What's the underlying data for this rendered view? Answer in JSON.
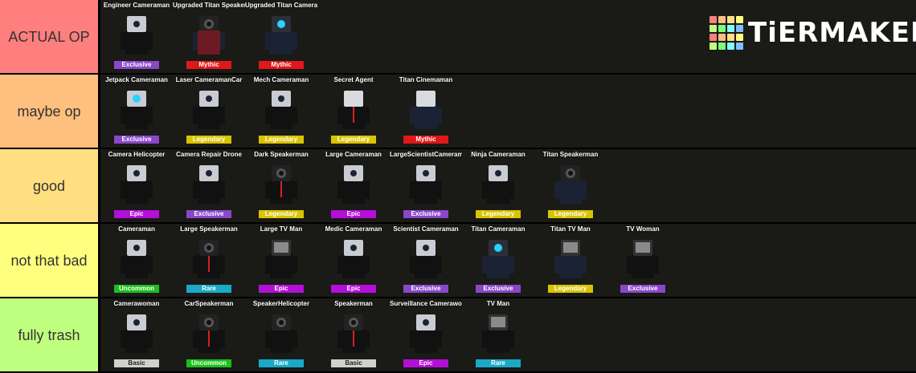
{
  "logo": {
    "text": "TiERMAKER",
    "grid_colors": [
      "#ff7f7f",
      "#ffbf7f",
      "#ffdf7f",
      "#ffff7f",
      "#bfff7f",
      "#7fff7f",
      "#7fffff",
      "#7fbfff",
      "#ff7f7f",
      "#ffbf7f",
      "#ffdf7f",
      "#ffff7f",
      "#bfff7f",
      "#7fff7f",
      "#7fffff",
      "#7fbfff"
    ]
  },
  "rarity_colors": {
    "Exclusive": "#8a47c9",
    "Mythic": "#e01818",
    "Legendary": "#d9c400",
    "Epic": "#b30fd6",
    "Rare": "#1aa9c7",
    "Uncommon": "#1cbf1c",
    "Basic": "#d0d0d0"
  },
  "tiers": [
    {
      "label": "ACTUAL OP",
      "color": "#ff7f7f",
      "items": [
        {
          "name": "Engineer Cameraman",
          "rarity": "Exclusive"
        },
        {
          "name": "Upgraded Titan Speakerman",
          "rarity": "Mythic"
        },
        {
          "name": "Upgraded Titan Cameraman",
          "rarity": "Mythic"
        }
      ]
    },
    {
      "label": "maybe op",
      "color": "#ffbf7f",
      "items": [
        {
          "name": "Jetpack Cameraman",
          "rarity": "Exclusive"
        },
        {
          "name": "Laser CameramanCar",
          "rarity": "Legendary"
        },
        {
          "name": "Mech Cameraman",
          "rarity": "Legendary"
        },
        {
          "name": "Secret Agent",
          "rarity": "Legendary"
        },
        {
          "name": "Titan Cinemaman",
          "rarity": "Mythic"
        }
      ]
    },
    {
      "label": "good",
      "color": "#ffdf7f",
      "items": [
        {
          "name": "Camera Helicopter",
          "rarity": "Epic"
        },
        {
          "name": "Camera Repair Drone",
          "rarity": "Exclusive"
        },
        {
          "name": "Dark Speakerman",
          "rarity": "Legendary"
        },
        {
          "name": "Large Cameraman",
          "rarity": "Epic"
        },
        {
          "name": "LargeScientistCameraman",
          "rarity": "Exclusive"
        },
        {
          "name": "Ninja Cameraman",
          "rarity": "Legendary"
        },
        {
          "name": "Titan Speakerman",
          "rarity": "Legendary"
        }
      ]
    },
    {
      "label": "not that bad",
      "color": "#ffff7f",
      "items": [
        {
          "name": "Cameraman",
          "rarity": "Uncommon"
        },
        {
          "name": "Large Speakerman",
          "rarity": "Rare"
        },
        {
          "name": "Large TV Man",
          "rarity": "Epic"
        },
        {
          "name": "Medic Cameraman",
          "rarity": "Epic"
        },
        {
          "name": "Scientist Cameraman",
          "rarity": "Exclusive"
        },
        {
          "name": "Titan Cameraman",
          "rarity": "Exclusive"
        },
        {
          "name": "Titan TV Man",
          "rarity": "Legendary"
        },
        {
          "name": "TV Woman",
          "rarity": "Exclusive"
        }
      ]
    },
    {
      "label": "fully trash",
      "color": "#bfff7f",
      "items": [
        {
          "name": "Camerawoman",
          "rarity": "Basic"
        },
        {
          "name": "CarSpeakerman",
          "rarity": "Uncommon"
        },
        {
          "name": "SpeakerHelicopter",
          "rarity": "Rare"
        },
        {
          "name": "Speakerman",
          "rarity": "Basic"
        },
        {
          "name": "Surveillance Camerawoman",
          "rarity": "Epic"
        },
        {
          "name": "TV Man",
          "rarity": "Rare"
        }
      ]
    }
  ]
}
